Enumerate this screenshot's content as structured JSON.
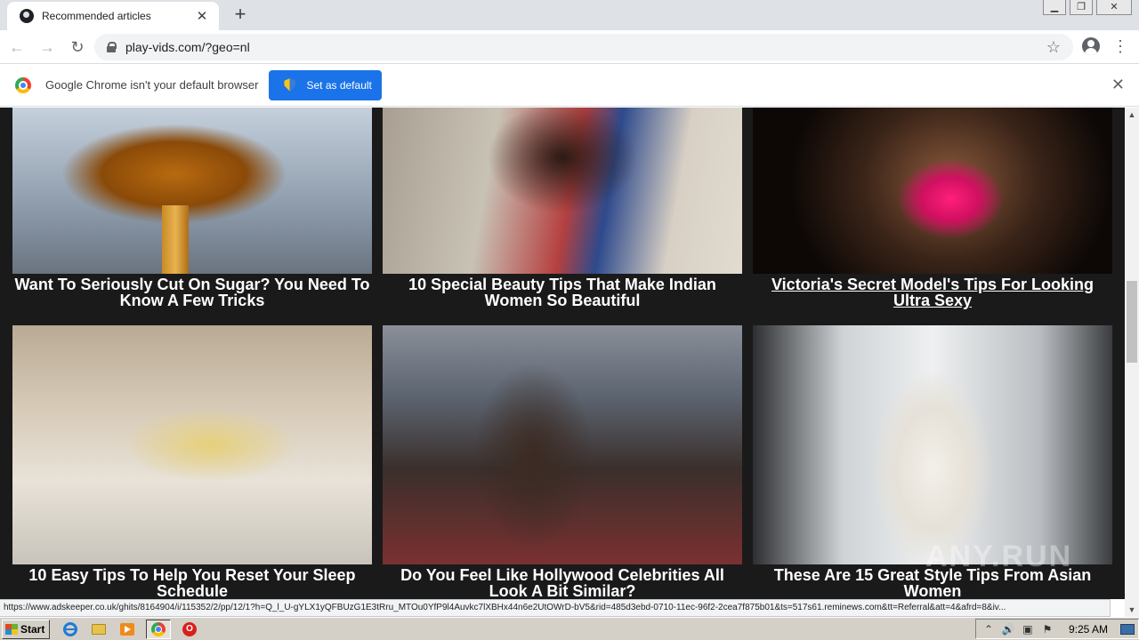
{
  "browser": {
    "tab": {
      "title": "Recommended articles",
      "close_glyph": "✕"
    },
    "new_tab_glyph": "+",
    "window_controls": {
      "minimize": "▁",
      "restore": "❐",
      "close": "✕"
    },
    "nav": {
      "back": "←",
      "forward": "→",
      "reload": "↻"
    },
    "url": "play-vids.com/?geo=nl",
    "star_glyph": "☆",
    "menu_glyph": "⋮"
  },
  "infobar": {
    "message": "Google Chrome isn't your default browser",
    "button_label": "Set as default",
    "close_glyph": "✕"
  },
  "articles": [
    {
      "title": "Want To Seriously Cut On Sugar? You Need To Know A Few Tricks"
    },
    {
      "title": "10 Special Beauty Tips That Make Indian Women So Beautiful"
    },
    {
      "title": "Victoria's Secret Model's Tips For Looking Ultra Sexy"
    },
    {
      "title": "10 Easy Tips To Help You Reset Your Sleep Schedule"
    },
    {
      "title": "Do You Feel Like Hollywood Celebrities All Look A Bit Similar?"
    },
    {
      "title": "These Are 15 Great Style Tips From Asian Women"
    }
  ],
  "watermark": "ANY.RUN",
  "scrollbar": {
    "up_glyph": "▲",
    "down_glyph": "▼"
  },
  "status_url": "https://www.adskeeper.co.uk/ghits/8164904/i/115352/2/pp/12/1?h=Q_l_U-gYLX1yQFBUzG1E3tRru_MTOu0YfP9l4Auvkc7lXBHx44n6e2UtOWrD-bV5&rid=485d3ebd-0710-11ec-96f2-2cea7f875b01&ts=517s61.reminews.com&tt=Referral&att=4&afrd=8&iv...",
  "taskbar": {
    "start_label": "Start",
    "opera_glyph": "O",
    "tray": {
      "up_glyph": "⌃",
      "volume_glyph": "🔊",
      "network_glyph": "▣",
      "flag_glyph": "⚑"
    },
    "clock": "9:25 AM"
  }
}
